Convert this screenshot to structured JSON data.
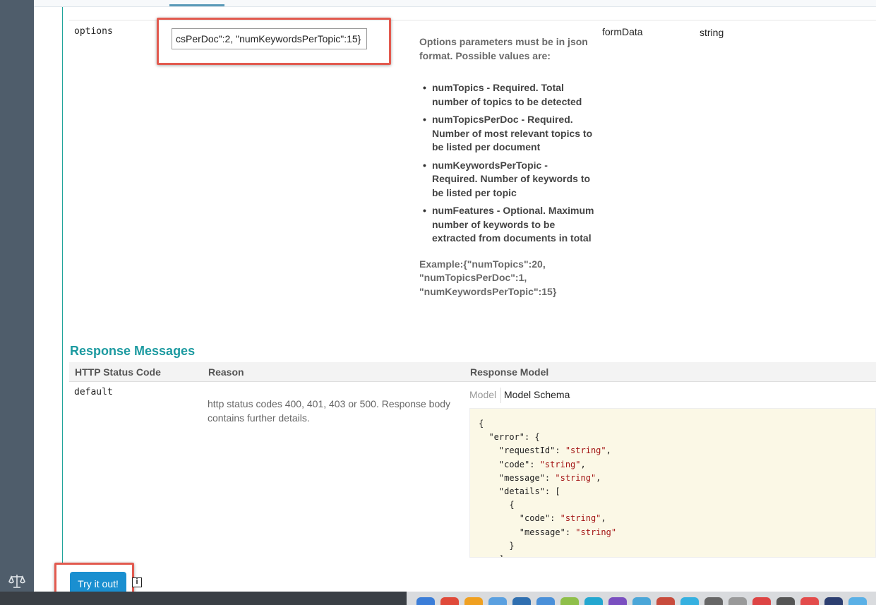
{
  "options_param": {
    "name": "options",
    "input_value": "csPerDoc\":2, \"numKeywordsPerTopic\":15}",
    "description_intro": "Options parameters must be in json format. Possible values are:",
    "bullets": [
      "numTopics - Required. Total number of topics to be detected",
      "numTopicsPerDoc - Required. Number of most relevant topics to be listed per document",
      "numKeywordsPerTopic - Required. Number of keywords to be listed per topic",
      "numFeatures - Optional. Maximum number of keywords to be extracted from documents in total"
    ],
    "example": "Example:{\"numTopics\":20, \"numTopicsPerDoc\":1, \"numKeywordsPerTopic\":15}",
    "param_type": "formData",
    "data_type": "string"
  },
  "response_messages": {
    "heading": "Response Messages",
    "columns": [
      "HTTP Status Code",
      "Reason",
      "Response Model"
    ],
    "rows": [
      {
        "code": "default",
        "reason": "http status codes 400, 401, 403 or 500. Response body contains further details."
      }
    ],
    "model_tabs": [
      "Model",
      "Model Schema"
    ],
    "active_model_tab": "Model Schema",
    "schema_lines": [
      "{",
      "  \"error\": {",
      "    \"requestId\": \"string\",",
      "    \"code\": \"string\",",
      "    \"message\": \"string\",",
      "    \"details\": [",
      "      {",
      "        \"code\": \"string\",",
      "        \"message\": \"string\"",
      "      }",
      "    ]"
    ]
  },
  "try_button_label": "Try it out!",
  "info_icon_glyph": "i",
  "colors": {
    "accent_teal": "#1c9aa0",
    "button_blue": "#1a8fd0",
    "highlight_red": "#e25a4f",
    "schema_bg": "#fbf8e6"
  },
  "icons": [
    "scale-icon",
    "info-icon"
  ]
}
